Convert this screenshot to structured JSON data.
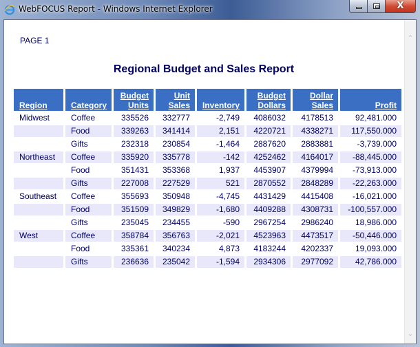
{
  "window": {
    "title": "WebFOCUS Report - Windows Internet Explorer",
    "controls": {
      "minimize": "minimize",
      "maximize": "restore",
      "close": "X"
    }
  },
  "report": {
    "page_label": "PAGE 1",
    "title": "Regional Budget and Sales Report",
    "columns": [
      {
        "line1": "",
        "line2": "Region"
      },
      {
        "line1": "",
        "line2": "Category"
      },
      {
        "line1": "Budget",
        "line2": "Units"
      },
      {
        "line1": "Unit",
        "line2": "Sales"
      },
      {
        "line1": "",
        "line2": "Inventory"
      },
      {
        "line1": "Budget",
        "line2": "Dollars"
      },
      {
        "line1": "Dollar",
        "line2": "Sales"
      },
      {
        "line1": "",
        "line2": "Profit"
      }
    ],
    "rows": [
      {
        "region": "Midwest",
        "category": "Coffee",
        "budget_units": "335526",
        "unit_sales": "332777",
        "inventory": "-2,749",
        "budget_dollars": "4086032",
        "dollar_sales": "4178513",
        "profit": "92,481.000"
      },
      {
        "region": "",
        "category": "Food",
        "budget_units": "339263",
        "unit_sales": "341414",
        "inventory": "2,151",
        "budget_dollars": "4220721",
        "dollar_sales": "4338271",
        "profit": "117,550.000"
      },
      {
        "region": "",
        "category": "Gifts",
        "budget_units": "232318",
        "unit_sales": "230854",
        "inventory": "-1,464",
        "budget_dollars": "2887620",
        "dollar_sales": "2883881",
        "profit": "-3,739.000"
      },
      {
        "region": "Northeast",
        "category": "Coffee",
        "budget_units": "335920",
        "unit_sales": "335778",
        "inventory": "-142",
        "budget_dollars": "4252462",
        "dollar_sales": "4164017",
        "profit": "-88,445.000"
      },
      {
        "region": "",
        "category": "Food",
        "budget_units": "351431",
        "unit_sales": "353368",
        "inventory": "1,937",
        "budget_dollars": "4453907",
        "dollar_sales": "4379994",
        "profit": "-73,913.000"
      },
      {
        "region": "",
        "category": "Gifts",
        "budget_units": "227008",
        "unit_sales": "227529",
        "inventory": "521",
        "budget_dollars": "2870552",
        "dollar_sales": "2848289",
        "profit": "-22,263.000"
      },
      {
        "region": "Southeast",
        "category": "Coffee",
        "budget_units": "355693",
        "unit_sales": "350948",
        "inventory": "-4,745",
        "budget_dollars": "4431429",
        "dollar_sales": "4415408",
        "profit": "-16,021.000"
      },
      {
        "region": "",
        "category": "Food",
        "budget_units": "351509",
        "unit_sales": "349829",
        "inventory": "-1,680",
        "budget_dollars": "4409288",
        "dollar_sales": "4308731",
        "profit": "-100,557.000"
      },
      {
        "region": "",
        "category": "Gifts",
        "budget_units": "235045",
        "unit_sales": "234455",
        "inventory": "-590",
        "budget_dollars": "2967254",
        "dollar_sales": "2986240",
        "profit": "18,986.000"
      },
      {
        "region": "West",
        "category": "Coffee",
        "budget_units": "358784",
        "unit_sales": "356763",
        "inventory": "-2,021",
        "budget_dollars": "4523963",
        "dollar_sales": "4473517",
        "profit": "-50,446.000"
      },
      {
        "region": "",
        "category": "Food",
        "budget_units": "335361",
        "unit_sales": "340234",
        "inventory": "4,873",
        "budget_dollars": "4183244",
        "dollar_sales": "4202337",
        "profit": "19,093.000"
      },
      {
        "region": "",
        "category": "Gifts",
        "budget_units": "236636",
        "unit_sales": "235042",
        "inventory": "-1,594",
        "budget_dollars": "2934306",
        "dollar_sales": "2977092",
        "profit": "42,786.000"
      }
    ]
  },
  "colors": {
    "header_bg": "#3a6fc4",
    "text": "#000066",
    "shade_row": "#e8e8fa"
  }
}
